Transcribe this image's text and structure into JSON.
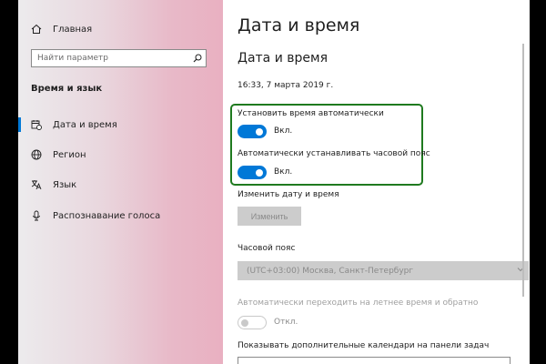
{
  "sidebar": {
    "home_label": "Главная",
    "search_placeholder": "Найти параметр",
    "section_title": "Время и язык",
    "items": [
      {
        "label": "Дата и время",
        "icon": "calendar-clock-icon",
        "active": true
      },
      {
        "label": "Регион",
        "icon": "globe-icon",
        "active": false
      },
      {
        "label": "Язык",
        "icon": "language-icon",
        "active": false
      },
      {
        "label": "Распознавание голоса",
        "icon": "microphone-icon",
        "active": false
      }
    ]
  },
  "main": {
    "page_title": "Дата и время",
    "section_title": "Дата и время",
    "current_time": "16:33, 7 марта 2019 г.",
    "auto_time": {
      "label": "Установить время автоматически",
      "state": "Вкл.",
      "on": true
    },
    "auto_timezone": {
      "label": "Автоматически устанавливать часовой пояс",
      "state": "Вкл.",
      "on": true
    },
    "change_datetime": {
      "label": "Изменить дату и время",
      "button": "Изменить"
    },
    "timezone": {
      "label": "Часовой пояс",
      "value": "(UTC+03:00) Москва, Санкт-Петербург"
    },
    "dst": {
      "label": "Автоматически переходить на летнее время и обратно",
      "state": "Откл.",
      "on": false
    },
    "calendars": {
      "label": "Показывать дополнительные календари на панели задач"
    }
  },
  "colors": {
    "accent": "#0078d7",
    "highlight_border": "#1f7a1f",
    "disabled_bg": "#cccccc"
  }
}
